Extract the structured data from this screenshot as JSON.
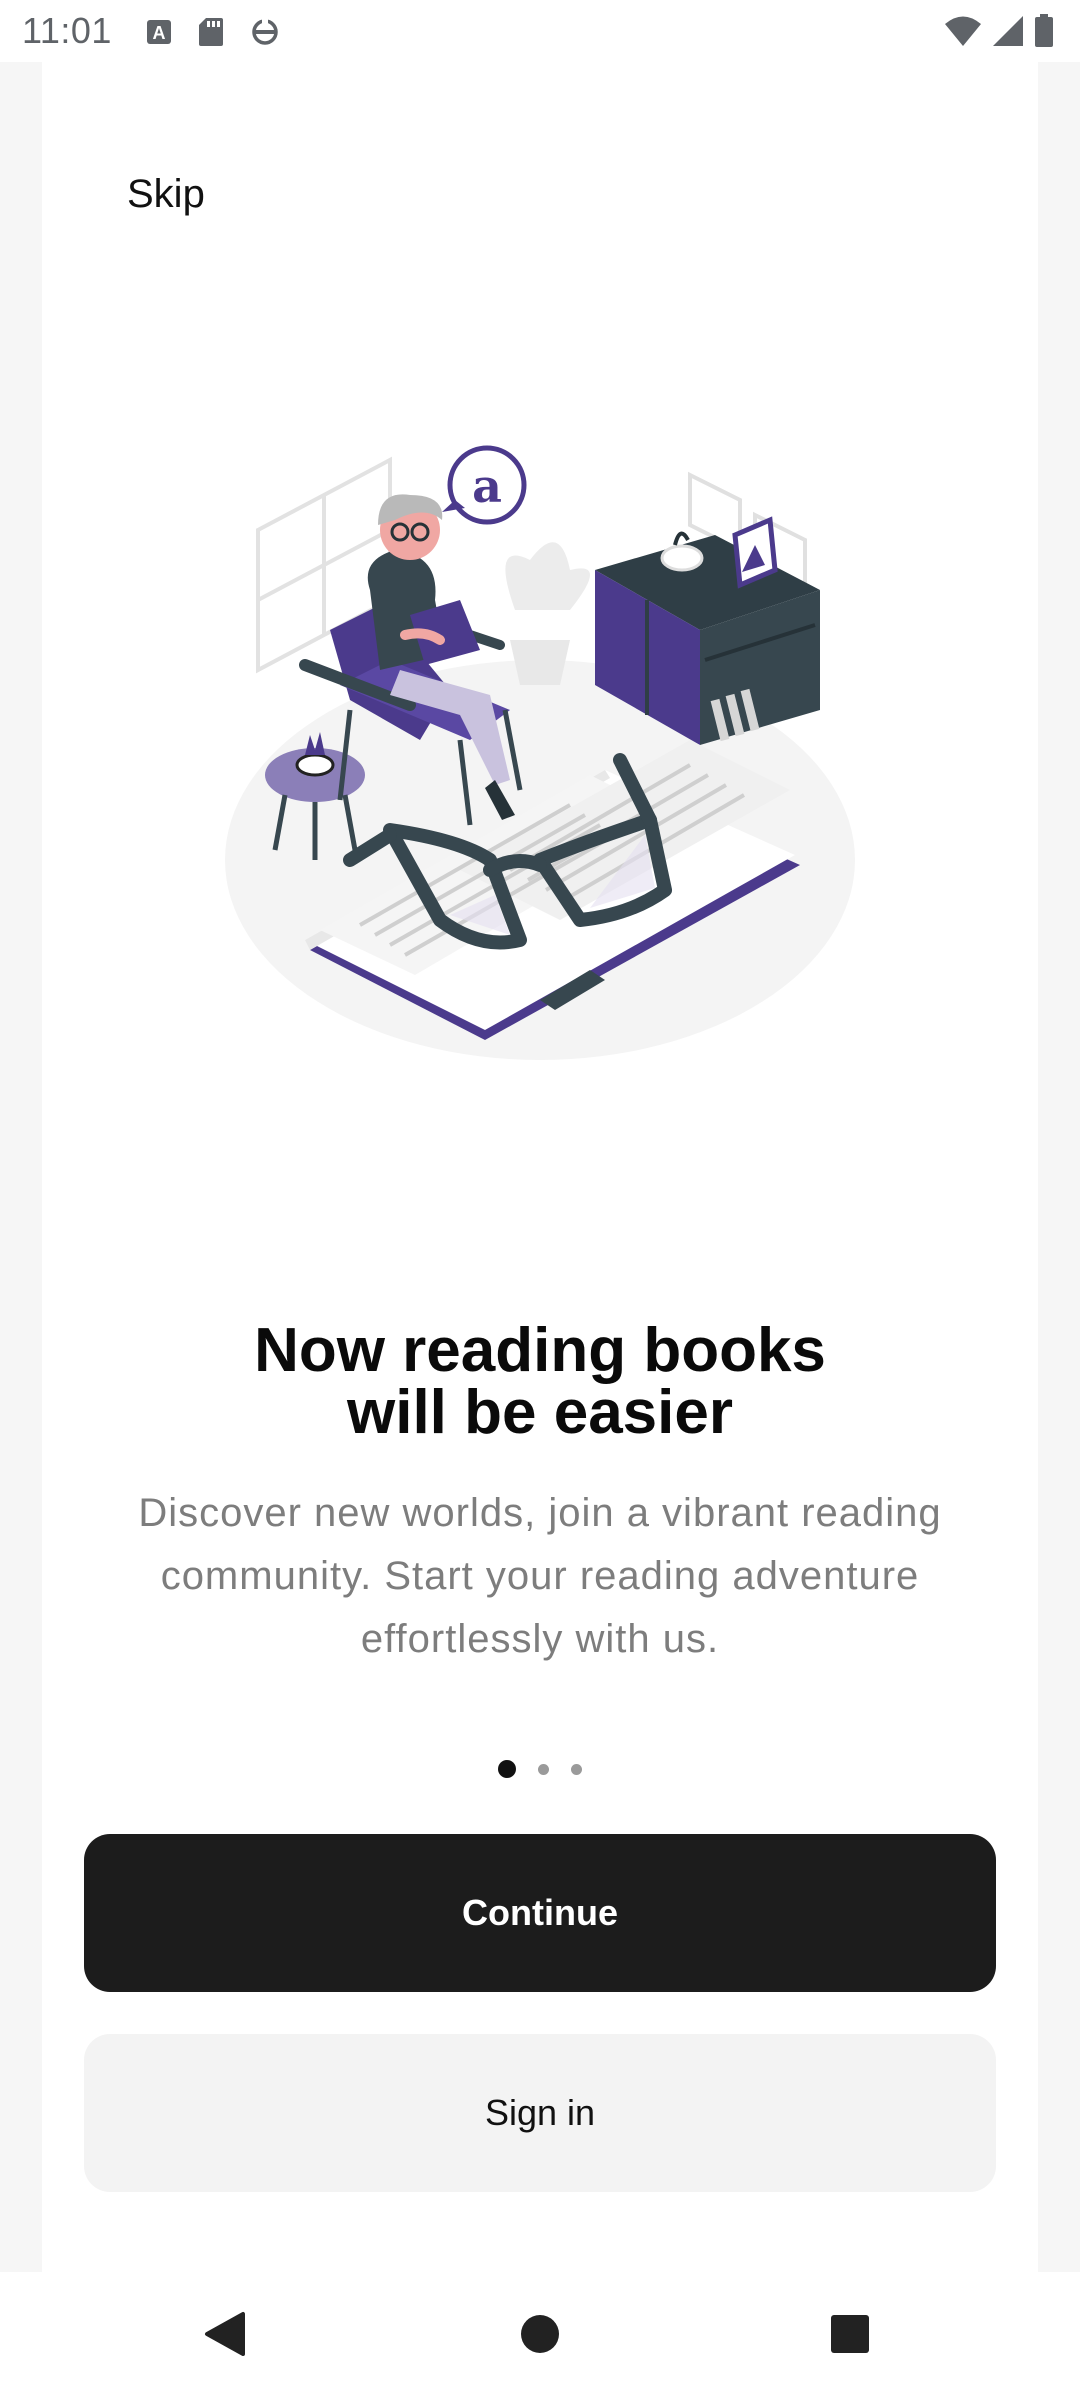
{
  "status_bar": {
    "time": "11:01",
    "left_icons": [
      "text-a-icon",
      "sd-card-icon",
      "data-saver-icon"
    ],
    "right_icons": [
      "wifi-icon",
      "cellular-signal-icon",
      "battery-icon"
    ]
  },
  "header": {
    "skip_label": "Skip"
  },
  "onboarding": {
    "illustration": "reading-books-illustration",
    "title": "Now reading books\nwill be easier",
    "description": "Discover new worlds, join a vibrant reading community. Start your reading adventure effortlessly with us.",
    "page_indicator": {
      "total": 3,
      "current": 1
    }
  },
  "actions": {
    "continue_label": "Continue",
    "signin_label": "Sign in"
  },
  "nav_bar": {
    "back_icon": "back-triangle-icon",
    "home_icon": "home-circle-icon",
    "recents_icon": "recents-square-icon"
  },
  "colors": {
    "accent_purple": "#4b3a8c",
    "dark_slate": "#37474f",
    "primary_button": "#1c1c1c",
    "secondary_button": "#f3f3f3",
    "subtext": "#7d7d7d"
  }
}
